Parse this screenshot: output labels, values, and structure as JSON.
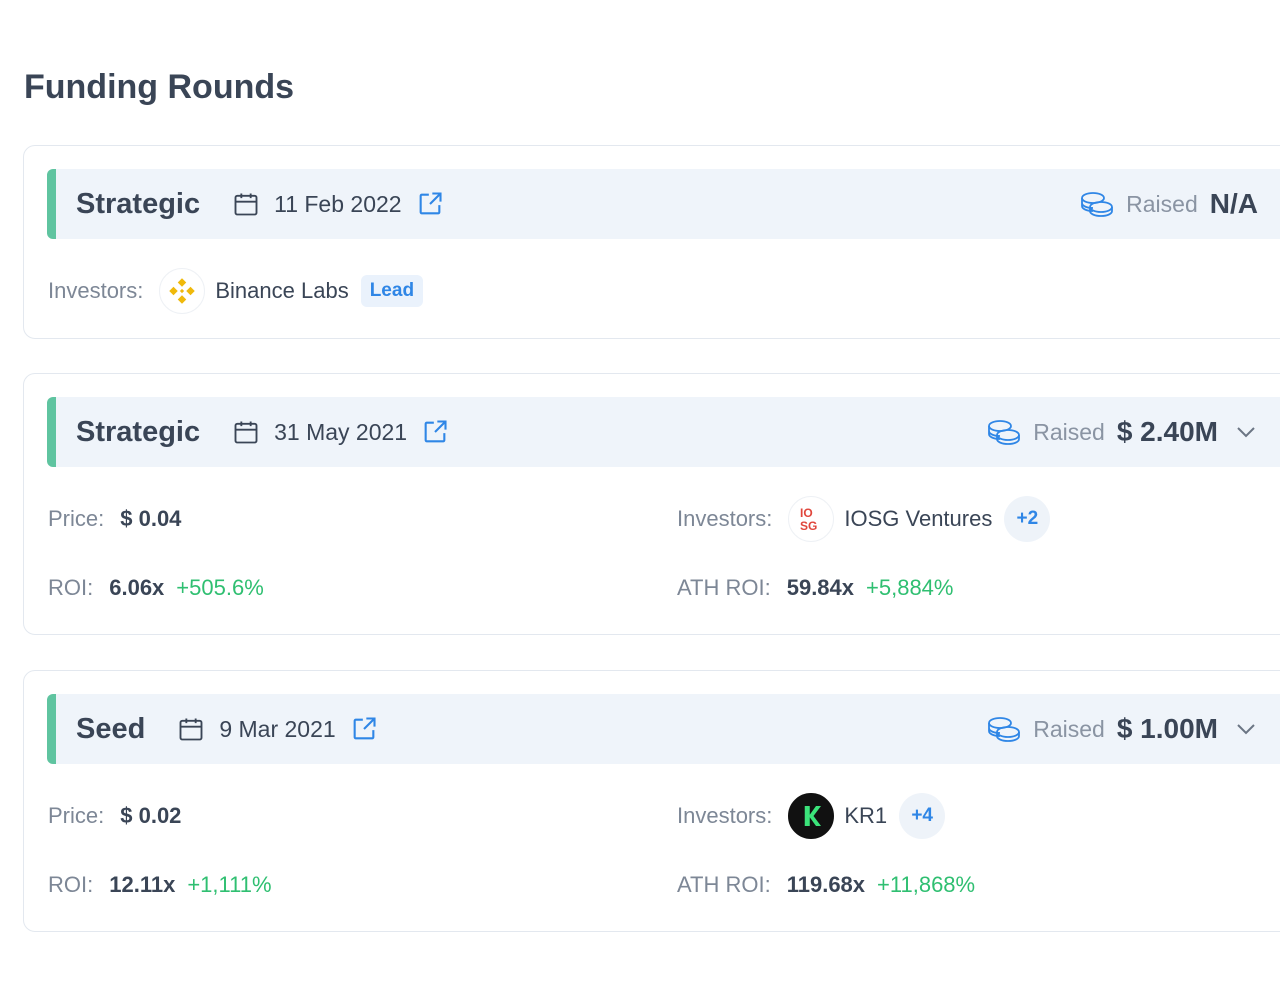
{
  "title": "Funding Rounds",
  "colors": {
    "accent_bar": "#5fc4a0",
    "link_blue": "#2f86e6",
    "positive": "#2fbf71"
  },
  "rounds": [
    {
      "type": "Strategic",
      "date": "11 Feb 2022",
      "raised_label": "Raised",
      "raised": "N/A",
      "investors_label": "Investors:",
      "investor": "Binance Labs",
      "lead": "Lead"
    },
    {
      "type": "Strategic",
      "date": "31 May 2021",
      "raised_label": "Raised",
      "raised": "$ 2.40M",
      "price_label": "Price:",
      "price": "$ 0.04",
      "roi_label": "ROI:",
      "roi": "6.06x",
      "roi_pct": "+505.6%",
      "investors_label": "Investors:",
      "investor": "IOSG Ventures",
      "more": "+2",
      "ath_label": "ATH ROI:",
      "ath": "59.84x",
      "ath_pct": "+5,884%"
    },
    {
      "type": "Seed",
      "date": "9 Mar 2021",
      "raised_label": "Raised",
      "raised": "$ 1.00M",
      "price_label": "Price:",
      "price": "$ 0.02",
      "roi_label": "ROI:",
      "roi": "12.11x",
      "roi_pct": "+1,111%",
      "investors_label": "Investors:",
      "investor": "KR1",
      "more": "+4",
      "ath_label": "ATH ROI:",
      "ath": "119.68x",
      "ath_pct": "+11,868%"
    }
  ]
}
